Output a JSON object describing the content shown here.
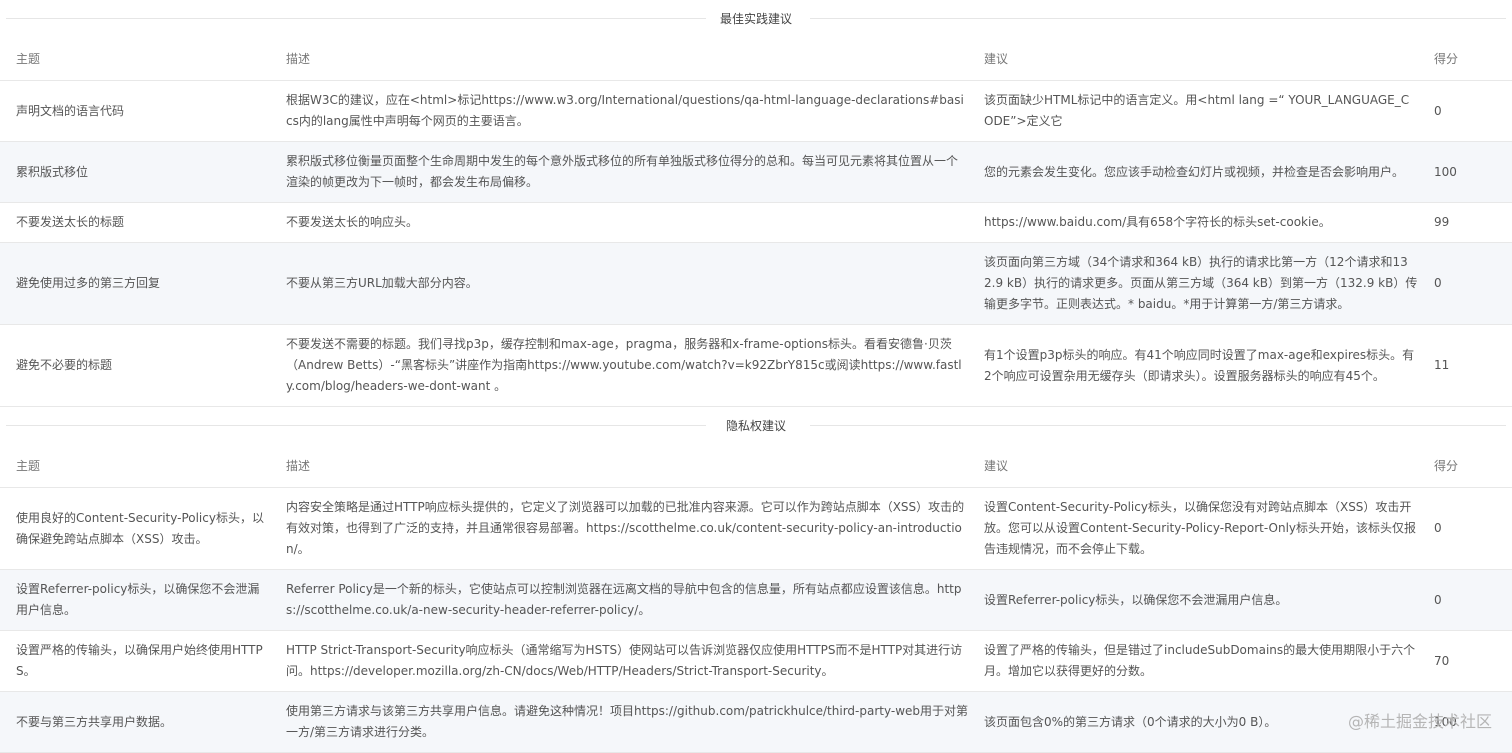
{
  "best_practices": {
    "title": "最佳实践建议",
    "headers": [
      "主题",
      "描述",
      "建议",
      "得分"
    ],
    "rows": [
      {
        "topic": "声明文档的语言代码",
        "description": "根据W3C的建议，应在<html>标记https://www.w3.org/International/questions/qa-html-language-declarations#basics内的lang属性中声明每个网页的主要语言。",
        "suggestion": "该页面缺少HTML标记中的语言定义。用<html lang =“ YOUR_LANGUAGE_CODE”>定义它",
        "score": "0"
      },
      {
        "topic": "累积版式移位",
        "description": "累积版式移位衡量页面整个生命周期中发生的每个意外版式移位的所有单独版式移位得分的总和。每当可见元素将其位置从一个渲染的帧更改为下一帧时，都会发生布局偏移。",
        "suggestion": "您的元素会发生变化。您应该手动检查幻灯片或视频，并检查是否会影响用户。",
        "score": "100"
      },
      {
        "topic": "不要发送太长的标题",
        "description": "不要发送太长的响应头。",
        "suggestion": "https://www.baidu.com/具有658个字符长的标头set-cookie。",
        "score": "99"
      },
      {
        "topic": "避免使用过多的第三方回复",
        "description": "不要从第三方URL加载大部分内容。",
        "suggestion": "该页面向第三方域（34个请求和364 kB）执行的请求比第一方（12个请求和132.9 kB）执行的请求更多。页面从第三方域（364 kB）到第一方（132.9 kB）传输更多字节。正则表达式。* baidu。*用于计算第一方/第三方请求。",
        "score": "0"
      },
      {
        "topic": "避免不必要的标题",
        "description": "不要发送不需要的标题。我们寻找p3p，缓存控制和max-age，pragma，服务器和x-frame-options标头。看看安德鲁·贝茨（Andrew Betts）-“黑客标头”讲座作为指南https://www.youtube.com/watch?v=k92ZbrY815c或阅读https://www.fastly.com/blog/headers-we-dont-want 。",
        "suggestion": "有1个设置p3p标头的响应。有41个响应同时设置了max-age和expires标头。有2个响应可设置杂用无缓存头（即请求头）。设置服务器标头的响应有45个。",
        "score": "11"
      }
    ]
  },
  "privacy": {
    "title": "隐私权建议",
    "headers": [
      "主题",
      "描述",
      "建议",
      "得分"
    ],
    "rows": [
      {
        "topic": "使用良好的Content-Security-Policy标头，以确保避免跨站点脚本（XSS）攻击。",
        "description": "内容安全策略是通过HTTP响应标头提供的，它定义了浏览器可以加载的已批准内容来源。它可以作为跨站点脚本（XSS）攻击的有效对策，也得到了广泛的支持，并且通常很容易部署。https://scotthelme.co.uk/content-security-policy-an-introduction/。",
        "suggestion": "设置Content-Security-Policy标头，以确保您没有对跨站点脚本（XSS）攻击开放。您可以从设置Content-Security-Policy-Report-Only标头开始，该标头仅报告违规情况，而不会停止下载。",
        "score": "0"
      },
      {
        "topic": "设置Referrer-policy标头，以确保您不会泄漏用户信息。",
        "description": "Referrer Policy是一个新的标头，它使站点可以控制浏览器在远离文档的导航中包含的信息量，所有站点都应设置该信息。https://scotthelme.co.uk/a-new-security-header-referrer-policy/。",
        "suggestion": "设置Referrer-policy标头，以确保您不会泄漏用户信息。",
        "score": "0"
      },
      {
        "topic": "设置严格的传输头，以确保用户始终使用HTTPS。",
        "description": "HTTP Strict-Transport-Security响应标头（通常缩写为HSTS）使网站可以告诉浏览器仅应使用HTTPS而不是HTTP对其进行访问。https://developer.mozilla.org/zh-CN/docs/Web/HTTP/Headers/Strict-Transport-Security。",
        "suggestion": "设置了严格的传输头，但是错过了includeSubDomains的最大使用期限小于六个月。增加它以获得更好的分数。",
        "score": "70"
      },
      {
        "topic": "不要与第三方共享用户数据。",
        "description": "使用第三方请求与该第三方共享用户信息。请避免这种情况！项目https://github.com/patrickhulce/third-party-web用于对第一方/第三方请求进行分类。",
        "suggestion": "该页面包含0%的第三方请求（0个请求的大小为0 B）。",
        "score": "100"
      }
    ]
  },
  "watermark": "@稀土掘金技术社区"
}
